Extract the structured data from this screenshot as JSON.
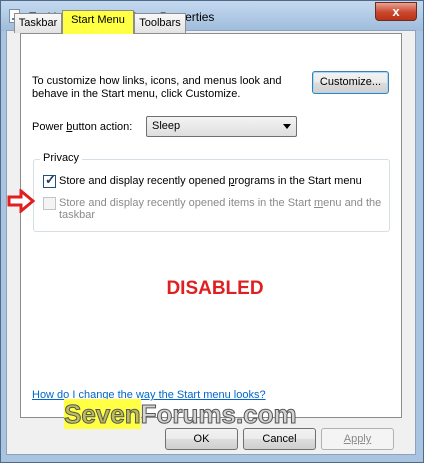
{
  "window": {
    "title": "Taskbar and Start Menu Properties",
    "close_glyph": "x"
  },
  "tabs": [
    {
      "label": "Taskbar"
    },
    {
      "label": "Start Menu"
    },
    {
      "label": "Toolbars"
    }
  ],
  "intro_text": "To customize how links, icons, and menus look and behave in the Start menu, click Customize.",
  "customize_button": "Customize...",
  "power": {
    "label_before": "Power ",
    "label_mnemonic": "b",
    "label_after": "utton action:",
    "value": "Sleep"
  },
  "privacy": {
    "label": "Privacy",
    "option1": {
      "before": "Store and display recently opened ",
      "mnemonic": "p",
      "after": "rograms in the Start menu",
      "checked": true
    },
    "option2": {
      "before": "Store and display recently opened items in the Start ",
      "mnemonic": "m",
      "after": "enu and the taskbar",
      "checked": false,
      "enabled": false
    }
  },
  "annotation": "DISABLED",
  "help_link": "How do I change the way the Start menu looks?",
  "watermark": {
    "part1": "Seven",
    "part2": "Forums.com"
  },
  "buttons": {
    "ok": "OK",
    "cancel": "Cancel",
    "apply": "Apply"
  },
  "colors": {
    "highlight": "#ffff44",
    "annotation": "#e02020",
    "link": "#0066cc",
    "arrow": "#e02020"
  },
  "icons": {
    "arrow": "red-outline-arrow-right-icon"
  }
}
